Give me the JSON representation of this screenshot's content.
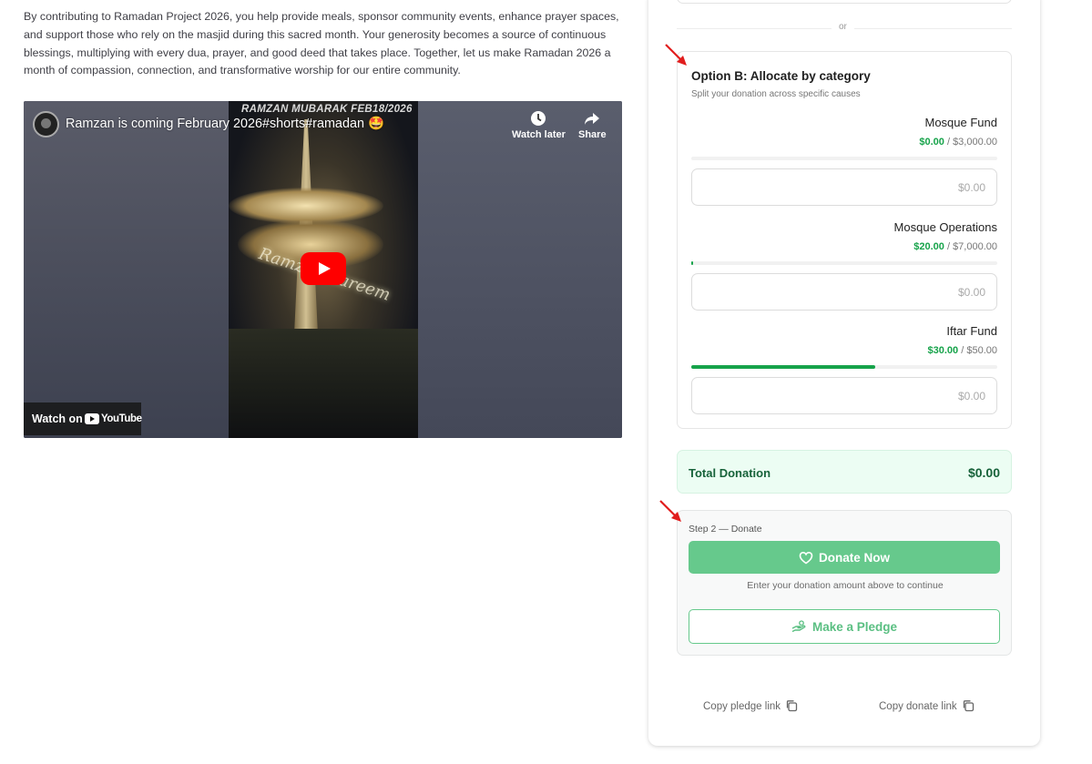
{
  "intro": {
    "text": "By contributing to Ramadan Project 2026, you help provide meals, sponsor community events, enhance prayer spaces, and support those who rely on the masjid during this sacred month. Your generosity becomes a source of continuous blessings, multiplying with every dua, prayer, and good deed that takes place. Together, let us make Ramadan 2026 a month of compassion, connection, and transformative worship for our entire community."
  },
  "video": {
    "title": "Ramzan is coming February 2026#shorts#ramadan 🤩",
    "overlay_text": "RAMZAN MUBARAK FEB18/2026",
    "frame_text": "Ramzan Kareem",
    "watch_later": "Watch later",
    "share": "Share",
    "watch_on": "Watch on",
    "youtube": "YouTube"
  },
  "donation": {
    "or_label": "or",
    "option_b": {
      "title": "Option B: Allocate by category",
      "subtitle": "Split your donation across specific causes",
      "categories": [
        {
          "name": "Mosque Fund",
          "raised": "$0.00",
          "goal": "$3,000.00",
          "progress": 0,
          "placeholder": "$0.00"
        },
        {
          "name": "Mosque Operations",
          "raised": "$20.00",
          "goal": "$7,000.00",
          "progress": 0.003,
          "placeholder": "$0.00"
        },
        {
          "name": "Iftar Fund",
          "raised": "$30.00",
          "goal": "$50.00",
          "progress": 0.6,
          "placeholder": "$0.00"
        }
      ]
    },
    "total": {
      "label": "Total Donation",
      "value": "$0.00"
    },
    "step2": {
      "label": "Step 2 — Donate",
      "donate_button": "Donate Now",
      "hint": "Enter your donation amount above to continue",
      "pledge_button": "Make a Pledge"
    },
    "links": {
      "copy_pledge": "Copy pledge link",
      "copy_donate": "Copy donate link"
    }
  },
  "colors": {
    "green": "#16a34a",
    "button_green": "#66c98c",
    "arrow_red": "#e11d1d"
  }
}
